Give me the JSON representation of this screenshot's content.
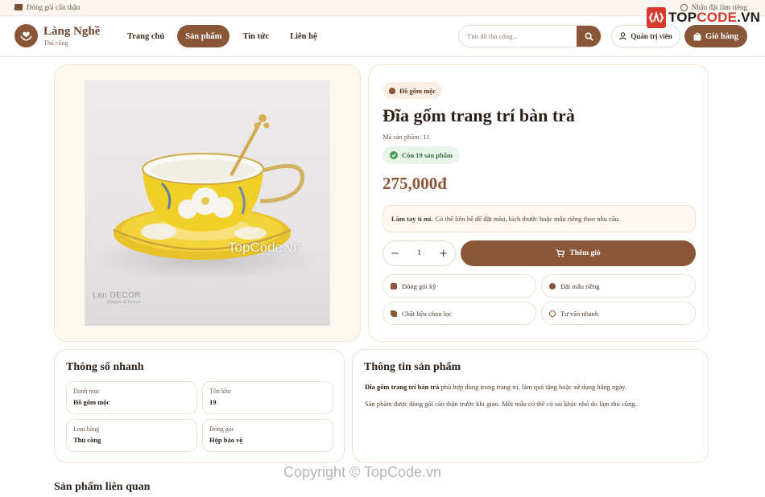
{
  "topbar": {
    "left_text": "Đóng gói cẩn thận",
    "right_text": "Nhận đặt làm riêng"
  },
  "watermark": {
    "logo_prefix": "TOP",
    "logo_accent": "CODE",
    "logo_suffix": ".VN",
    "photo_text": "TopCode.vn",
    "copyright": "Copyright © TopCode.vn"
  },
  "brand": {
    "name": "Làng Nghề",
    "sub": "Thủ công"
  },
  "nav": {
    "items": [
      "Trang chủ",
      "Sản phẩm",
      "Tin tức",
      "Liên hệ"
    ],
    "active": "Sản phẩm"
  },
  "search": {
    "placeholder": "Tìm đồ thủ công..."
  },
  "header_buttons": {
    "admin": "Quản trị viên",
    "cart": "Giỏ hàng"
  },
  "gallery": {
    "photo_brand": "Lan DECOR",
    "photo_brand_sub": "Simple & Decor"
  },
  "product": {
    "category": "Đồ gốm mộc",
    "title": "Đĩa gốm trang trí bàn trà",
    "sku": "Mã sản phẩm: 11",
    "stock": "Còn 19 sản phẩm",
    "price": "275,000đ",
    "note_bold": "Làm tay tỉ mỉ.",
    "note_text": "Có thể liên hệ để đặt màu, kích thước hoặc mẫu riêng theo nhu cầu.",
    "quantity": "1",
    "add_to_cart": "Thêm giỏ",
    "features": [
      "Đóng gói kỹ",
      "Đặt mẫu riêng",
      "Chất liệu chọn lọc",
      "Tư vấn nhanh"
    ]
  },
  "specs": {
    "title": "Thông số nhanh",
    "items": [
      {
        "label": "Danh mục",
        "value": "Đồ gốm mộc"
      },
      {
        "label": "Tồn kho",
        "value": "19"
      },
      {
        "label": "Loại hàng",
        "value": "Thủ công"
      },
      {
        "label": "Đóng gói",
        "value": "Hộp bảo vệ"
      }
    ]
  },
  "details": {
    "title": "Thông tin sản phẩm",
    "p1_bold": "Đĩa gốm trang trí bàn trà",
    "p1_text": "phù hợp dùng trong trang trí, làm quà tặng hoặc sử dụng hằng ngày.",
    "p2": "Sản phẩm được đóng gói cẩn thận trước khi giao. Mỗi mẫu có thể có sai khác nhỏ do làm thủ công."
  },
  "related": {
    "title": "Sản phẩm liên quan"
  },
  "colors": {
    "accent": "#8a5638",
    "success": "#4c9a58",
    "watermark_red": "#d63a2c"
  }
}
